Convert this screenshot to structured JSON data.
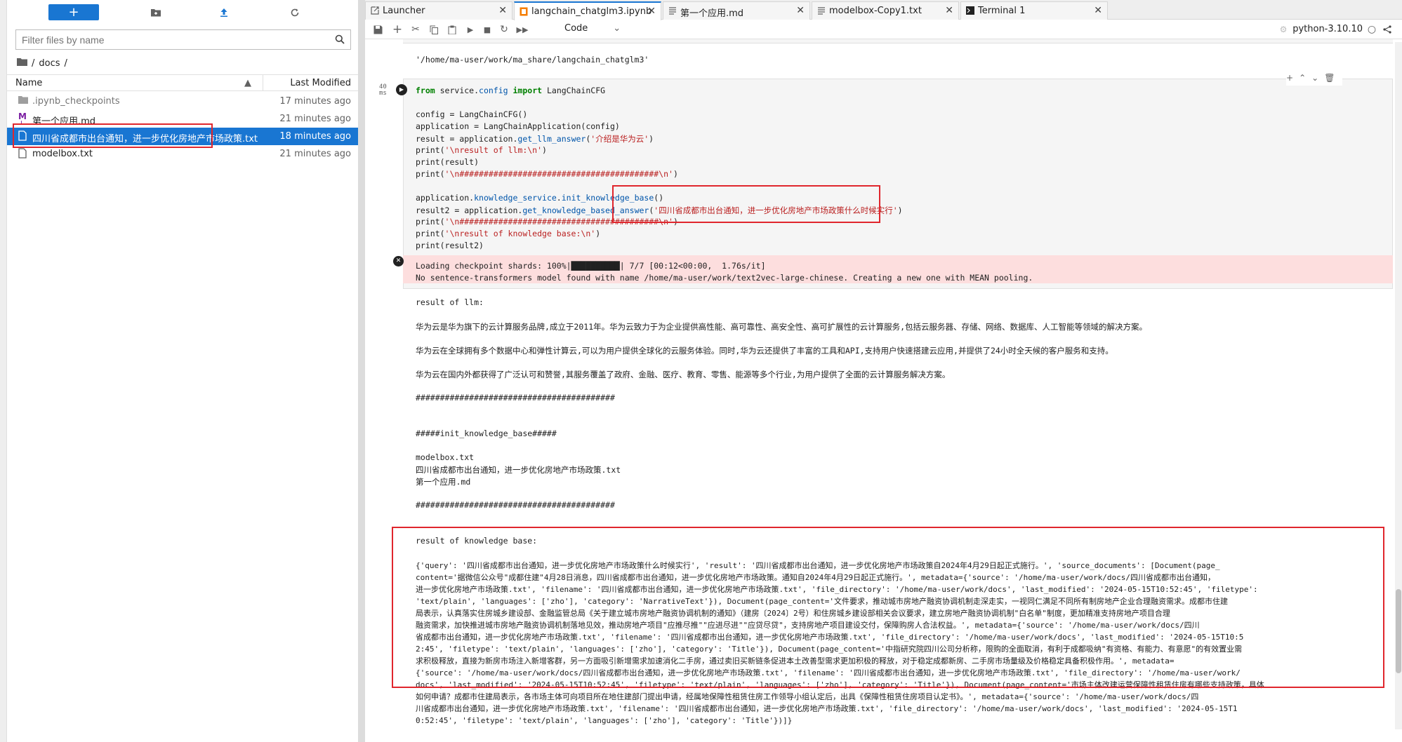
{
  "file_browser": {
    "filter_placeholder": "Filter files by name",
    "breadcrumb_root": "/",
    "breadcrumb_dir": "docs",
    "breadcrumb_trail": "/",
    "col_name": "Name",
    "col_modified": "Last Modified",
    "files": [
      {
        "name": ".ipynb_checkpoints",
        "modified": "17 minutes ago",
        "type": "folder"
      },
      {
        "name": "第一个应用.md",
        "modified": "21 minutes ago",
        "type": "markdown"
      },
      {
        "name": "四川省成都市出台通知，进一步优化房地产市场政策.txt",
        "modified": "18 minutes ago",
        "type": "text"
      },
      {
        "name": "modelbox.txt",
        "modified": "21 minutes ago",
        "type": "text"
      }
    ]
  },
  "tabs": [
    {
      "label": "Launcher",
      "icon": "launcher-icon"
    },
    {
      "label": "langchain_chatglm3.ipynb",
      "icon": "notebook-icon"
    },
    {
      "label": "第一个应用.md",
      "icon": "markdown-icon"
    },
    {
      "label": "modelbox-Copy1.txt",
      "icon": "text-file-icon"
    },
    {
      "label": "Terminal 1",
      "icon": "terminal-icon"
    }
  ],
  "toolbar": {
    "cell_type": "Code",
    "kernel": "python-3.10.10"
  },
  "notebook": {
    "prev_output": "'/home/ma-user/work/ma_share/langchain_chatglm3'",
    "exec_time_1": "40",
    "exec_time_2": "ms",
    "code": {
      "l1a": "from",
      "l1b": " service.",
      "l1c": "config",
      "l1d": " ",
      "l1e": "import",
      "l1f": " LangChainCFG",
      "l2": "config = LangChainCFG()",
      "l3": "application = LangChainApplication(config)",
      "l4a": "result = application.",
      "l4b": "get_llm_answer",
      "l4c": "(",
      "l4d": "'介绍是华为云'",
      "l4e": ")",
      "l5a": "print(",
      "l5b": "'\\nresult of llm:\\n'",
      "l5c": ")",
      "l6": "print(result)",
      "l7a": "print(",
      "l7b": "'\\n#########################################\\n'",
      "l7c": ")",
      "l8a": "application.",
      "l8b": "knowledge_service",
      "l8c": ".",
      "l8d": "init_knowledge_base",
      "l8e": "()",
      "l9a": "result2 = application.",
      "l9b": "get_knowledge_based_answer",
      "l9c": "(",
      "l9d": "'四川省成都市出台通知，进一步优化房地产市场政策什么时候实行'",
      "l9e": ")",
      "l10a": "print(",
      "l10b": "'\\n#########################################\\n'",
      "l10c": ")",
      "l11a": "print(",
      "l11b": "'\\nresult of knowledge base:\\n'",
      "l11c": ")",
      "l12": "print(result2)"
    },
    "stderr": [
      "Loading checkpoint shards: 100%|██████████| 7/7 [00:12<00:00,  1.76s/it]",
      "No sentence-transformers model found with name /home/ma-user/work/text2vec-large-chinese. Creating a new one with MEAN pooling."
    ],
    "stdout_llm": [
      "result of llm:",
      "华为云是华为旗下的云计算服务品牌,成立于2011年。华为云致力于为企业提供高性能、高可靠性、高安全性、高可扩展性的云计算服务,包括云服务器、存储、网络、数据库、人工智能等领域的解决方案。",
      "华为云在全球拥有多个数据中心和弹性计算云,可以为用户提供全球化的云服务体验。同时,华为云还提供了丰富的工具和API,支持用户快速搭建云应用,并提供了24小时全天候的客户服务和支持。",
      "华为云在国内外都获得了广泛认可和赞誉,其服务覆盖了政府、金融、医疗、教育、零售、能源等多个行业,为用户提供了全面的云计算服务解决方案。",
      "#########################################",
      "#####init_knowledge_base#####",
      "modelbox.txt",
      "四川省成都市出台通知，进一步优化房地产市场政策.txt",
      "第一个应用.md",
      "#########################################"
    ],
    "stdout_kb": [
      "result of knowledge base:",
      "{'query': '四川省成都市出台通知，进一步优化房地产市场政策什么时候实行', 'result': '四川省成都市出台通知，进一步优化房地产市场政策自2024年4月29日起正式施行。', 'source_documents': [Document(page_",
      "content='据微信公众号\"成都住建\"4月28日消息，四川省成都市出台通知，进一步优化房地产市场政策。通知自2024年4月29日起正式施行。', metadata={'source': '/home/ma-user/work/docs/四川省成都市出台通知，",
      "进一步优化房地产市场政策.txt', 'filename': '四川省成都市出台通知，进一步优化房地产市场政策.txt', 'file_directory': '/home/ma-user/work/docs', 'last_modified': '2024-05-15T10:52:45', 'filetype':",
      "'text/plain', 'languages': ['zho'], 'category': 'NarrativeText'}), Document(page_content='文件要求，推动城市房地产融资协调机制走深走实，一视同仁满足不同所有制房地产企业合理融资需求。成都市住建",
      "局表示，认真落实住房城乡建设部、金融监管总局《关于建立城市房地产融资协调机制的通知》（建房〔2024〕2号）和住房城乡建设部相关会议要求，建立房地产融资协调机制\"白名单\"制度，更加精准支持房地产项目合理",
      "融资需求，加快推进城市房地产融资协调机制落地见效，推动房地产项目\"应推尽推\"\"应进尽进\"\"应贷尽贷\"，支持房地产项目建设交付，保障购房人合法权益。', metadata={'source': '/home/ma-user/work/docs/四川",
      "省成都市出台通知，进一步优化房地产市场政策.txt', 'filename': '四川省成都市出台通知，进一步优化房地产市场政策.txt', 'file_directory': '/home/ma-user/work/docs', 'last_modified': '2024-05-15T10:5",
      "2:45', 'filetype': 'text/plain', 'languages': ['zho'], 'category': 'Title'}), Document(page_content='中指研究院四川公司分析称，限购的全面取消，有利于成都吸纳\"有资格、有能力、有意愿\"的有效置业需",
      "求积极释放，直接为新房市场注入新增客群，另一方面吸引新增需求加速消化二手房，通过卖旧买新链条促进本土改善型需求更加积极的释放，对于稳定成都新房、二手房市场量级及价格稳定具备积极作用。', metadata=",
      "{'source': '/home/ma-user/work/docs/四川省成都市出台通知，进一步优化房地产市场政策.txt', 'filename': '四川省成都市出台通知，进一步优化房地产市场政策.txt', 'file_directory': '/home/ma-user/work/",
      "docs', 'last_modified': '2024-05-15T10:52:45', 'filetype': 'text/plain', 'languages': ['zho'], 'category': 'Title'}), Document(page_content='市场主体改建运营保障性租赁住房有哪些支持政策，具体",
      "如何申请？成都市住建局表示，各市场主体可向项目所在地住建部门提出申请，经属地保障性租赁住房工作领导小组认定后，出具《保障性租赁住房项目认定书》。', metadata={'source': '/home/ma-user/work/docs/四",
      "川省成都市出台通知，进一步优化房地产市场政策.txt', 'filename': '四川省成都市出台通知，进一步优化房地产市场政策.txt', 'file_directory': '/home/ma-user/work/docs', 'last_modified': '2024-05-15T1",
      "0:52:45', 'filetype': 'text/plain', 'languages': ['zho'], 'category': 'Title'})]}"
    ]
  },
  "colors": {
    "accent": "#1976d2",
    "highlight": "#e0262d",
    "error_bg": "#fddede"
  }
}
